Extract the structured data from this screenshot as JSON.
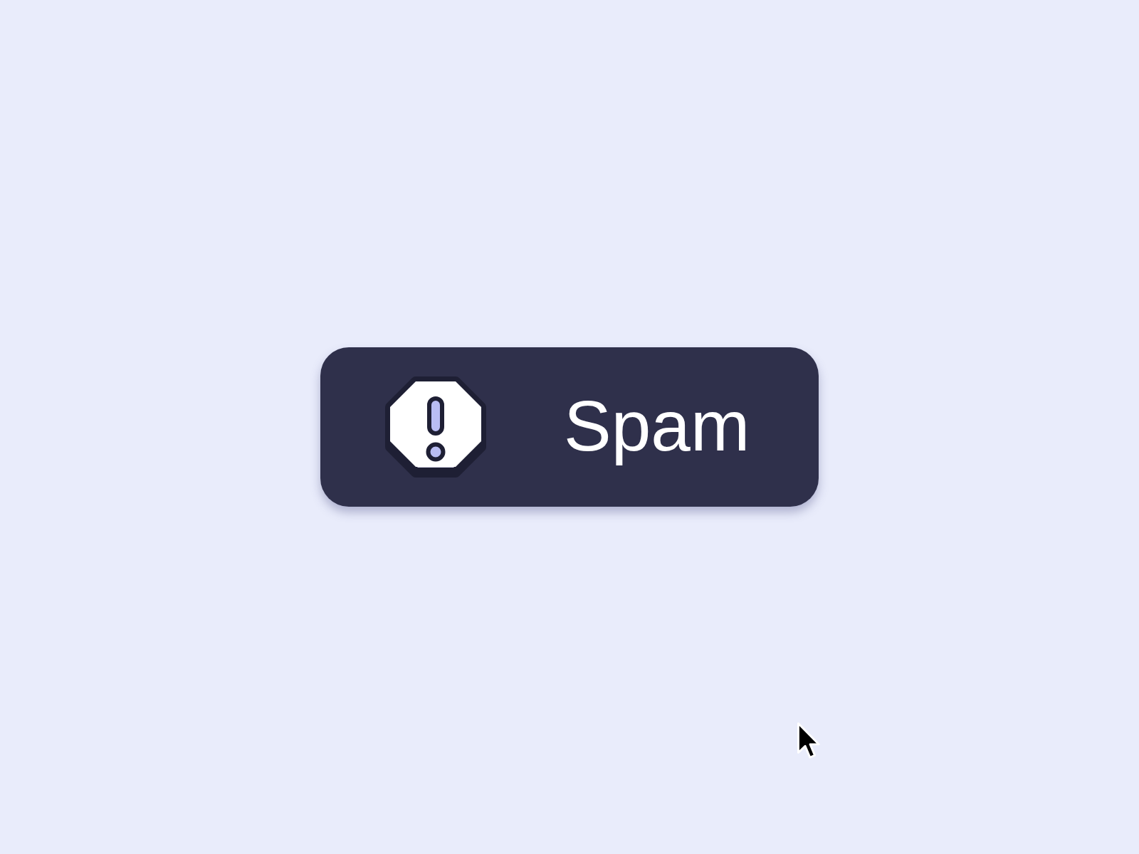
{
  "button": {
    "label": "Spam"
  }
}
